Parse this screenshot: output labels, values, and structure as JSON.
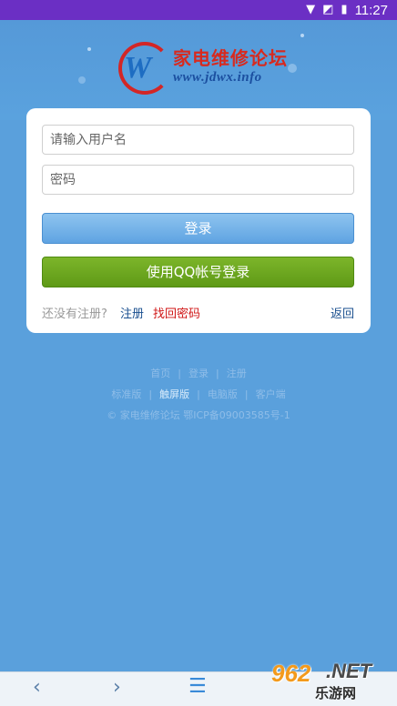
{
  "status_bar": {
    "time": "11:27",
    "icons": [
      "wifi-icon",
      "signal-icon",
      "battery-icon"
    ]
  },
  "header": {
    "logo_title": "家电维修论坛",
    "logo_url": "www.jdwx.info",
    "logo_letter": "W"
  },
  "login": {
    "username_placeholder": "请输入用户名",
    "password_placeholder": "密码",
    "login_button": "登录",
    "qq_button": "使用QQ帐号登录",
    "no_account_text": "还没有注册?",
    "register_link": "注册",
    "forgot_link": "找回密码",
    "back_link": "返回"
  },
  "footer": {
    "row1": [
      "首页",
      "登录",
      "注册"
    ],
    "row2": [
      "标准版",
      "触屏版",
      "电脑版",
      "客户端"
    ],
    "copyright": "© 家电维修论坛 鄂ICP备09003585号-1"
  },
  "bottom_nav": {
    "back_icon": "‹",
    "forward_icon": "›",
    "menu_icon": "☰"
  },
  "watermark": {
    "number": "962",
    "suffix": ".NET",
    "text": "乐游网"
  },
  "colors": {
    "status_bar": "#6b2fc4",
    "background": "#5aa0dc",
    "login_button": "#6aaee8",
    "qq_button": "#6ea620",
    "forgot_link": "#d01616"
  }
}
